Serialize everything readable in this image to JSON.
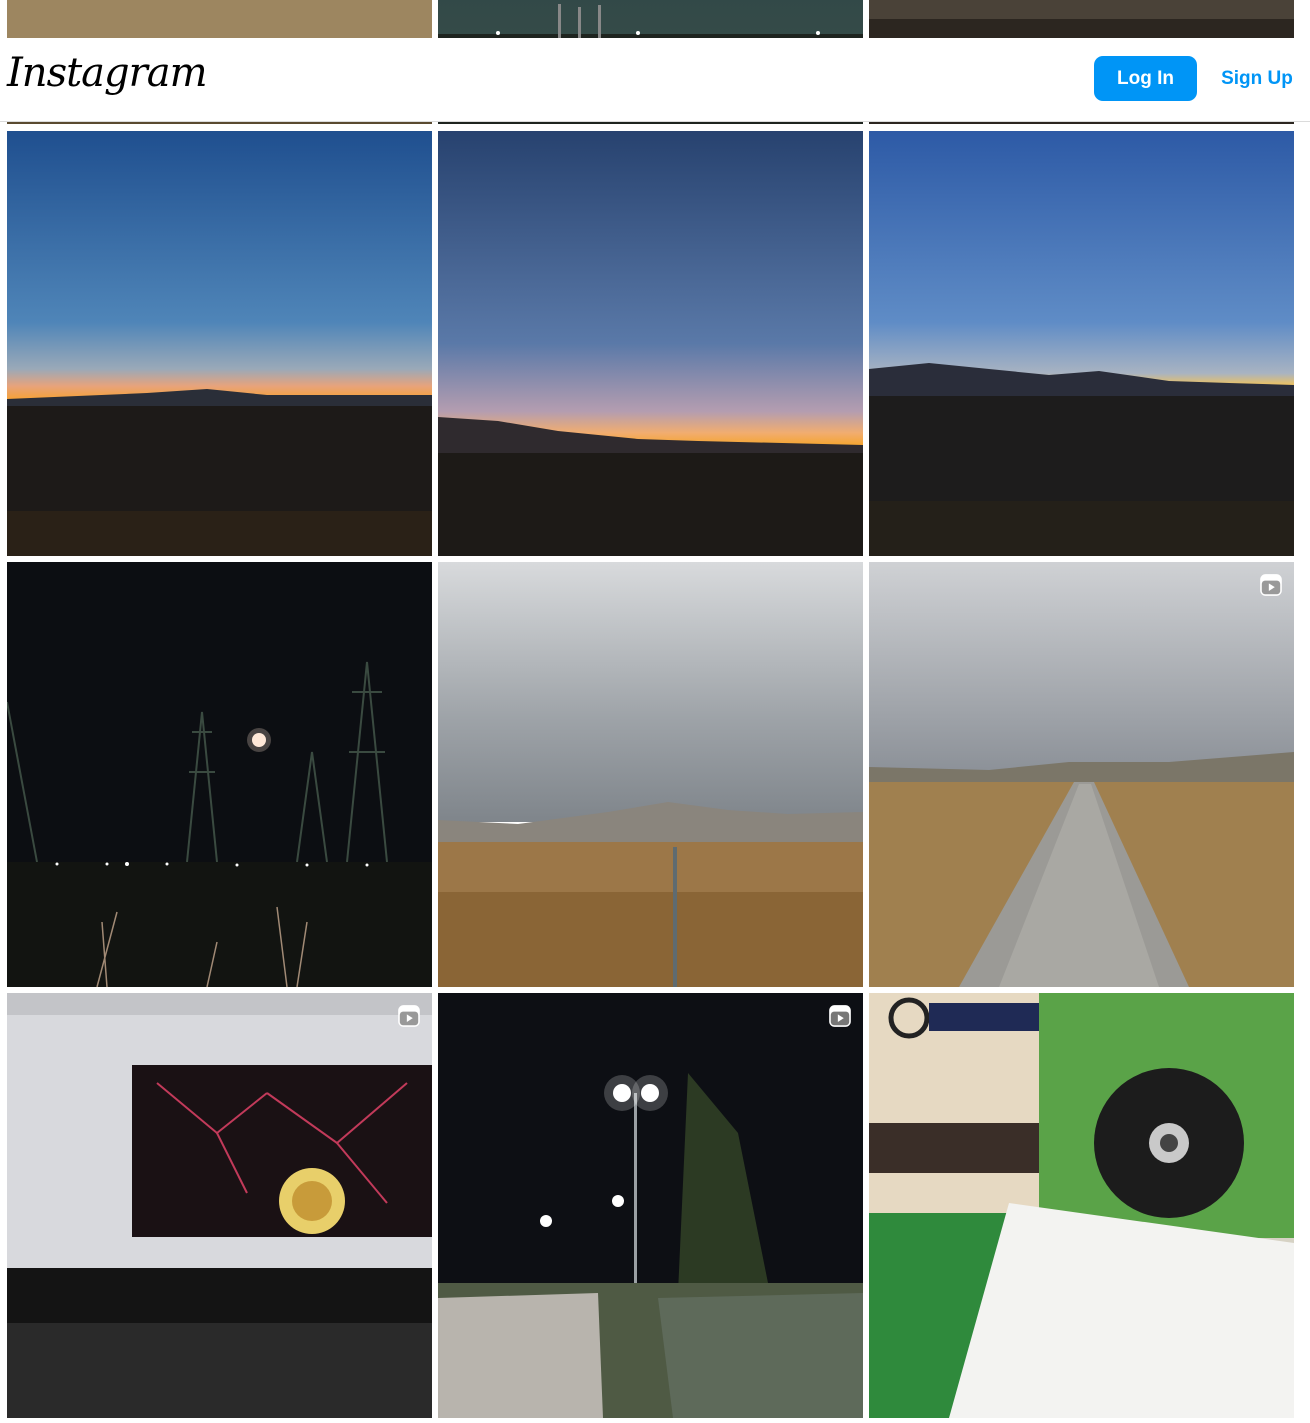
{
  "header": {
    "logo_text": "Instagram",
    "login_label": "Log In",
    "signup_label": "Sign Up"
  },
  "colors": {
    "accent": "#0095f6",
    "border": "#dbdbdb"
  },
  "posts": [
    {
      "kind": "dry-grass-field",
      "reel": false
    },
    {
      "kind": "twilight-powerlines",
      "reel": false
    },
    {
      "kind": "dusk-field",
      "reel": false
    },
    {
      "kind": "sunset-horizon",
      "reel": false
    },
    {
      "kind": "sunset-hills",
      "reel": false
    },
    {
      "kind": "sunset-mountains",
      "reel": false
    },
    {
      "kind": "night-moon-powerlines",
      "reel": false
    },
    {
      "kind": "cloudy-hills-field",
      "reel": false
    },
    {
      "kind": "gravel-path",
      "reel": true
    },
    {
      "kind": "laptop-screen",
      "reel": true
    },
    {
      "kind": "night-streetlights",
      "reel": true
    },
    {
      "kind": "disc-and-document",
      "reel": false
    }
  ]
}
